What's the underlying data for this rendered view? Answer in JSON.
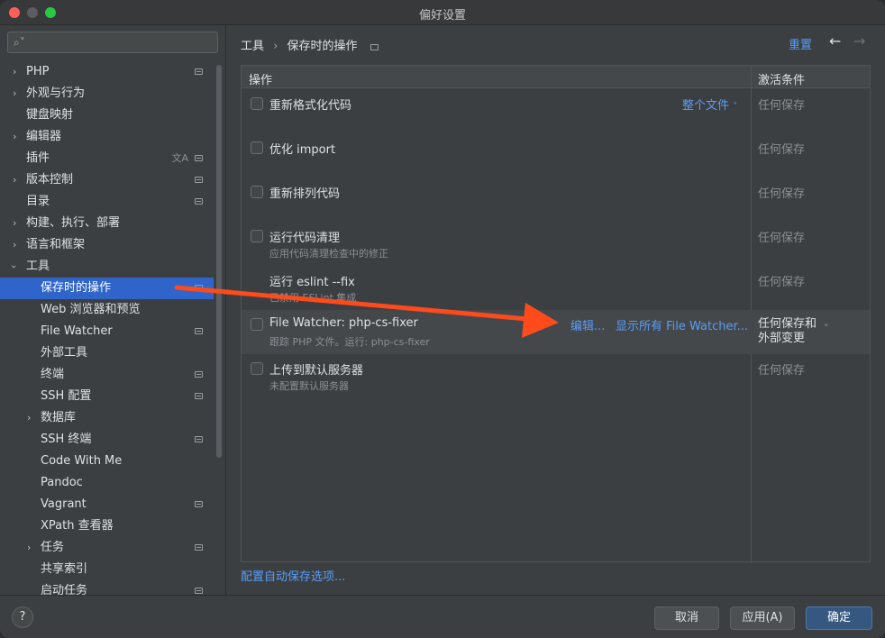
{
  "window": {
    "title": "偏好设置"
  },
  "sidebar": {
    "search_placeholder": "",
    "items": [
      {
        "label": "PHP",
        "expandable": true
      },
      {
        "label": "外观与行为",
        "expandable": true
      },
      {
        "label": "键盘映射",
        "expandable": false
      },
      {
        "label": "编辑器",
        "expandable": true
      },
      {
        "label": "插件",
        "expandable": false
      },
      {
        "label": "版本控制",
        "expandable": true
      },
      {
        "label": "目录",
        "expandable": false
      },
      {
        "label": "构建、执行、部署",
        "expandable": true
      },
      {
        "label": "语言和框架",
        "expandable": true
      },
      {
        "label": "工具",
        "expandable": true,
        "expanded": true
      },
      {
        "label": "保存时的操作",
        "selected": true
      },
      {
        "label": "Web 浏览器和预览"
      },
      {
        "label": "File Watcher"
      },
      {
        "label": "外部工具"
      },
      {
        "label": "终端"
      },
      {
        "label": "SSH 配置"
      },
      {
        "label": "数据库",
        "expandable": true
      },
      {
        "label": "SSH 终端"
      },
      {
        "label": "Code With Me"
      },
      {
        "label": "Pandoc"
      },
      {
        "label": "Vagrant"
      },
      {
        "label": "XPath 查看器"
      },
      {
        "label": "任务",
        "expandable": true
      },
      {
        "label": "共享索引"
      },
      {
        "label": "启动任务"
      }
    ]
  },
  "breadcrumb": {
    "parent": "工具",
    "separator": "›",
    "current": "保存时的操作"
  },
  "header": {
    "reset": "重置",
    "back_icon": "arrow-left-icon",
    "forward_icon": "arrow-right-icon"
  },
  "table": {
    "col_action": "操作",
    "col_condition": "激活条件",
    "rows": [
      {
        "title": "重新格式化代码",
        "subtitle": "",
        "condition": "任何保存",
        "scope": "整个文件"
      },
      {
        "title": "优化 import",
        "subtitle": "",
        "condition": "任何保存"
      },
      {
        "title": "重新排列代码",
        "subtitle": "",
        "condition": "任何保存"
      },
      {
        "title": "运行代码清理",
        "subtitle": "应用代码清理检查中的修正",
        "condition": "任何保存"
      },
      {
        "title": "运行 eslint --fix",
        "subtitle": "已禁用 ESLint 集成",
        "condition": "任何保存"
      },
      {
        "title": "File Watcher: php-cs-fixer",
        "subtitle": "跟踪 PHP 文件。运行: php-cs-fixer",
        "condition_line1": "任何保存和",
        "condition_line2": "外部变更",
        "edit_link": "编辑...",
        "show_all_link": "显示所有 File Watcher..."
      },
      {
        "title": "上传到默认服务器",
        "subtitle": "未配置默认服务器",
        "condition": "任何保存"
      }
    ]
  },
  "bottom_link": "配置自动保存选项...",
  "footer": {
    "help": "?",
    "cancel": "取消",
    "apply": "应用(A)",
    "ok": "确定"
  },
  "colors": {
    "accent": "#589df6",
    "selection": "#2f65ca",
    "annotation_arrow": "#ff4a1c"
  }
}
